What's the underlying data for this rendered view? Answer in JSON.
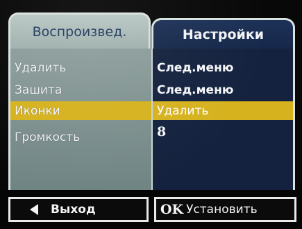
{
  "tabs": {
    "playback": "Воспроизвед.",
    "settings": "Настройки"
  },
  "menu": {
    "rows": [
      {
        "label": "Удалить",
        "value": "След.меню",
        "selected": false
      },
      {
        "label": "Зашита",
        "value": "След.меню",
        "selected": false
      },
      {
        "label": "Иконки",
        "value": "Удалить",
        "selected": true
      },
      {
        "label": "Громкость",
        "value": "8",
        "selected": false
      }
    ]
  },
  "footer": {
    "exit_label": "Выход",
    "ok_key": "OK",
    "set_label": "Установить",
    "exit_icon": "arrow-left-icon"
  },
  "colors": {
    "highlight": "#d6b21e",
    "left_panel": "#7f9291",
    "right_panel": "#14223f"
  }
}
